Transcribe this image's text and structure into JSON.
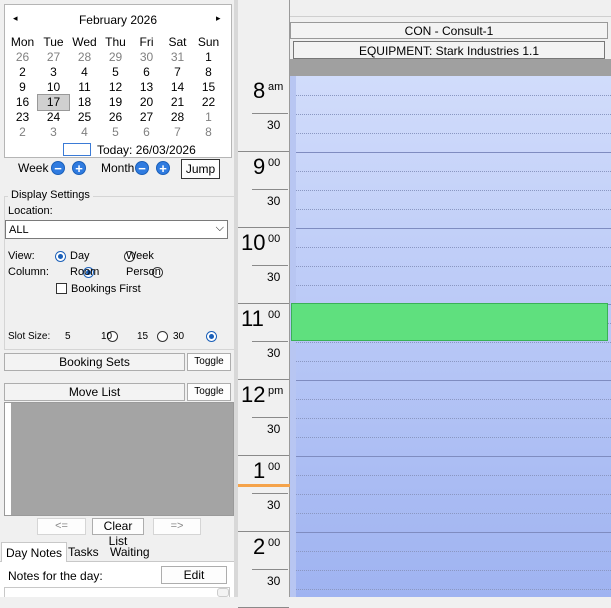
{
  "calendar": {
    "prev_icon": "◂",
    "next_icon": "▸",
    "title": "February 2026",
    "weekdays": [
      "Mon",
      "Tue",
      "Wed",
      "Thu",
      "Fri",
      "Sat",
      "Sun"
    ],
    "weeks": [
      [
        "26",
        "27",
        "28",
        "29",
        "30",
        "31",
        "1"
      ],
      [
        "2",
        "3",
        "4",
        "5",
        "6",
        "7",
        "8"
      ],
      [
        "9",
        "10",
        "11",
        "12",
        "13",
        "14",
        "15"
      ],
      [
        "16",
        "17",
        "18",
        "19",
        "20",
        "21",
        "22"
      ],
      [
        "23",
        "24",
        "25",
        "26",
        "27",
        "28",
        "1"
      ],
      [
        "2",
        "3",
        "4",
        "5",
        "6",
        "7",
        "8"
      ]
    ],
    "today_label": "Today: 26/03/2026"
  },
  "nav": {
    "week_label": "Week",
    "month_label": "Month",
    "minus_symbol": "−",
    "plus_symbol": "+",
    "jump_label": "Jump"
  },
  "display_settings": {
    "title": "Display Settings",
    "location_label": "Location:",
    "location_value": "ALL",
    "view_label": "View:",
    "view_day": "Day",
    "view_week": "Week",
    "column_label": "Column:",
    "column_room": "Room",
    "column_person": "Person",
    "bookings_first": "Bookings First",
    "slot_size_label": "Slot Size:",
    "slot_5": "5",
    "slot_10": "10",
    "slot_15": "15",
    "slot_30": "30"
  },
  "booking_sets": {
    "label": "Booking Sets",
    "toggle": "Toggle"
  },
  "move_list": {
    "label": "Move List",
    "toggle": "Toggle",
    "prev": "<=",
    "clear": "Clear List",
    "next": "=>"
  },
  "tabs": {
    "day_notes": "Day Notes",
    "tasks": "Tasks",
    "waiting": "Waiting"
  },
  "notes": {
    "label": "Notes for the day:",
    "edit": "Edit"
  },
  "schedule": {
    "con_header": "CON - Consult-1",
    "equipment_header": "EQUIPMENT: Stark Industries 1.1",
    "hours": [
      {
        "h": "8",
        "sup": "am"
      },
      {
        "h": "9",
        "sup": "00"
      },
      {
        "h": "10",
        "sup": "00"
      },
      {
        "h": "11",
        "sup": "00"
      },
      {
        "h": "12",
        "sup": "pm"
      },
      {
        "h": "1",
        "sup": "00"
      },
      {
        "h": "2",
        "sup": "00"
      }
    ],
    "half_label": "30"
  },
  "colors": {
    "booking": "#5fe07e",
    "grid_top": "#d1dcfb",
    "grid_bottom": "#9fb3f1",
    "now_line": "#f5a34a",
    "accent": "#2f7be0"
  }
}
